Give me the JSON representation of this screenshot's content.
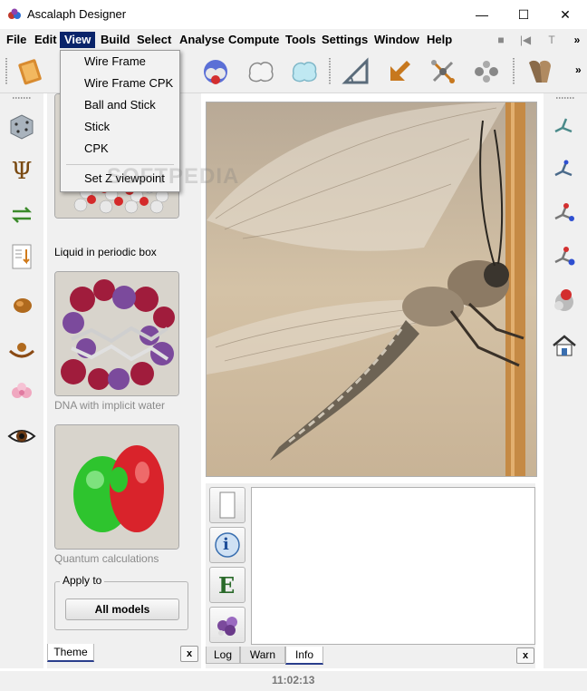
{
  "window": {
    "title": "Ascalaph Designer",
    "minimize": "—",
    "maximize": "☐",
    "close": "✕"
  },
  "menubar": {
    "items": [
      "File",
      "Edit",
      "View",
      "Build",
      "Select",
      "Analyse",
      "Compute",
      "Tools",
      "Settings",
      "Window",
      "Help"
    ],
    "active": "View",
    "right_icons": [
      "■",
      "|◀",
      "T",
      "»"
    ]
  },
  "view_menu": {
    "items": [
      "Wire Frame",
      "Wire Frame CPK",
      "Ball and Stick",
      "Stick",
      "CPK",
      "Set Z viewpoint"
    ]
  },
  "watermark": "SOFTPEDIA",
  "toolbar": {
    "overflow": "»",
    "icons": [
      "book-icon",
      "sphere-model-icon",
      "surface-outline-icon",
      "surface-filled-icon",
      "angle-tool-icon",
      "arrow-icon",
      "molecule-icon",
      "fragment-icon",
      "tooth-icon"
    ]
  },
  "left_dock": {
    "icons": [
      "dice-icon",
      "psi-icon",
      "exchange-arrows-icon",
      "document-list-icon",
      "seed-icon",
      "bowl-icon",
      "flower-icon",
      "eye-icon"
    ]
  },
  "theme_panel": {
    "captions": [
      "Liquid in periodic box",
      "DNA with implicit water",
      "Quantum calculations"
    ],
    "apply_to_label": "Apply to",
    "all_models_button": "All models",
    "tab_label": "Theme",
    "close": "x"
  },
  "log_panel": {
    "tabs": [
      "Log",
      "Warn",
      "Info"
    ],
    "selected_tab": "Info",
    "close": "x",
    "buttons": [
      "new-page-button",
      "info-button",
      "e-button",
      "molecule-button"
    ]
  },
  "buttons": {
    "info": "i",
    "e": "E"
  },
  "right_dock": {
    "icons": [
      "stick-molecule-icon-1",
      "stick-molecule-icon-2",
      "stick-molecule-icon-3",
      "stick-molecule-icon-4",
      "cpk-molecule-icon",
      "home-icon"
    ]
  },
  "status": {
    "time": "11:02:13"
  },
  "colors": {
    "menu_active_bg": "#0a246a",
    "tab_underline": "#2a3e8c"
  }
}
